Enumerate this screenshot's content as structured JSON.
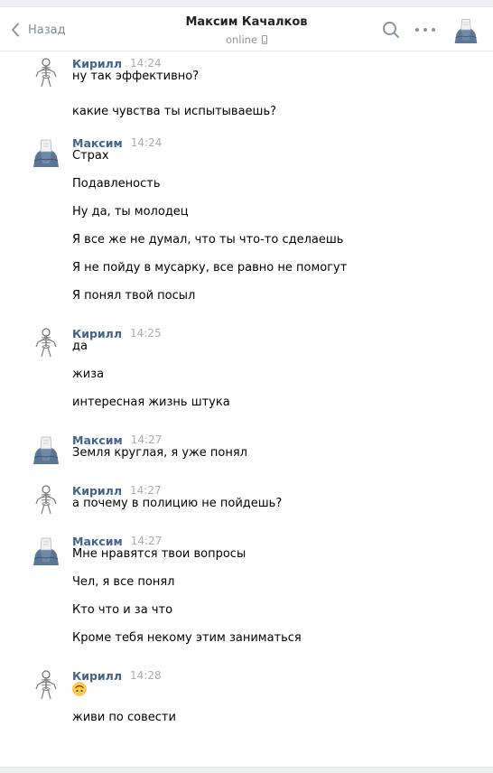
{
  "header": {
    "back_label": "Назад",
    "title": "Максим Качалков",
    "status": "online"
  },
  "messages": [
    {
      "author": "Кирилл",
      "time": "14:24",
      "avatar": "kirill",
      "lines": [
        "ну так эффективно?",
        "какие чувства ты испытываешь?"
      ]
    },
    {
      "author": "Максим",
      "time": "14:24",
      "avatar": "maxim",
      "lines": [
        "Страх",
        "Подавленость",
        "Ну да, ты молодец",
        "Я все же не думал, что ты что-то сделаешь",
        "Я не пойду в мусарку, все равно не помогут",
        "Я понял твой посыл"
      ]
    },
    {
      "author": "Кирилл",
      "time": "14:25",
      "avatar": "kirill",
      "lines": [
        "да",
        "жиза",
        "интересная жизнь штука"
      ]
    },
    {
      "author": "Максим",
      "time": "14:27",
      "avatar": "maxim",
      "lines": [
        "Земля круглая, я уже понял"
      ]
    },
    {
      "author": "Кирилл",
      "time": "14:27",
      "avatar": "kirill",
      "lines": [
        "а почему в полицию не пойдешь?"
      ]
    },
    {
      "author": "Максим",
      "time": "14:27",
      "avatar": "maxim",
      "lines": [
        "Мне нравятся твои вопросы",
        "Чел, я все понял",
        "Кто что и за что",
        "Кроме тебя некому этим заниматься"
      ]
    },
    {
      "author": "Кирилл",
      "time": "14:28",
      "avatar": "kirill",
      "lines": [
        "🙃",
        "живи по совести"
      ]
    }
  ],
  "icons": {
    "back": "chevron-left-icon",
    "search": "search-icon",
    "more": "more-dots-icon",
    "phone": "mobile-phone-icon",
    "emoji": "upside-down-face-emoji"
  },
  "colors": {
    "author_link": "#42648b",
    "timestamp": "#a8adb5",
    "icon_gray": "#8a93a1",
    "background": "#edeef0",
    "emoji_yellow": "#ffcc4d"
  }
}
